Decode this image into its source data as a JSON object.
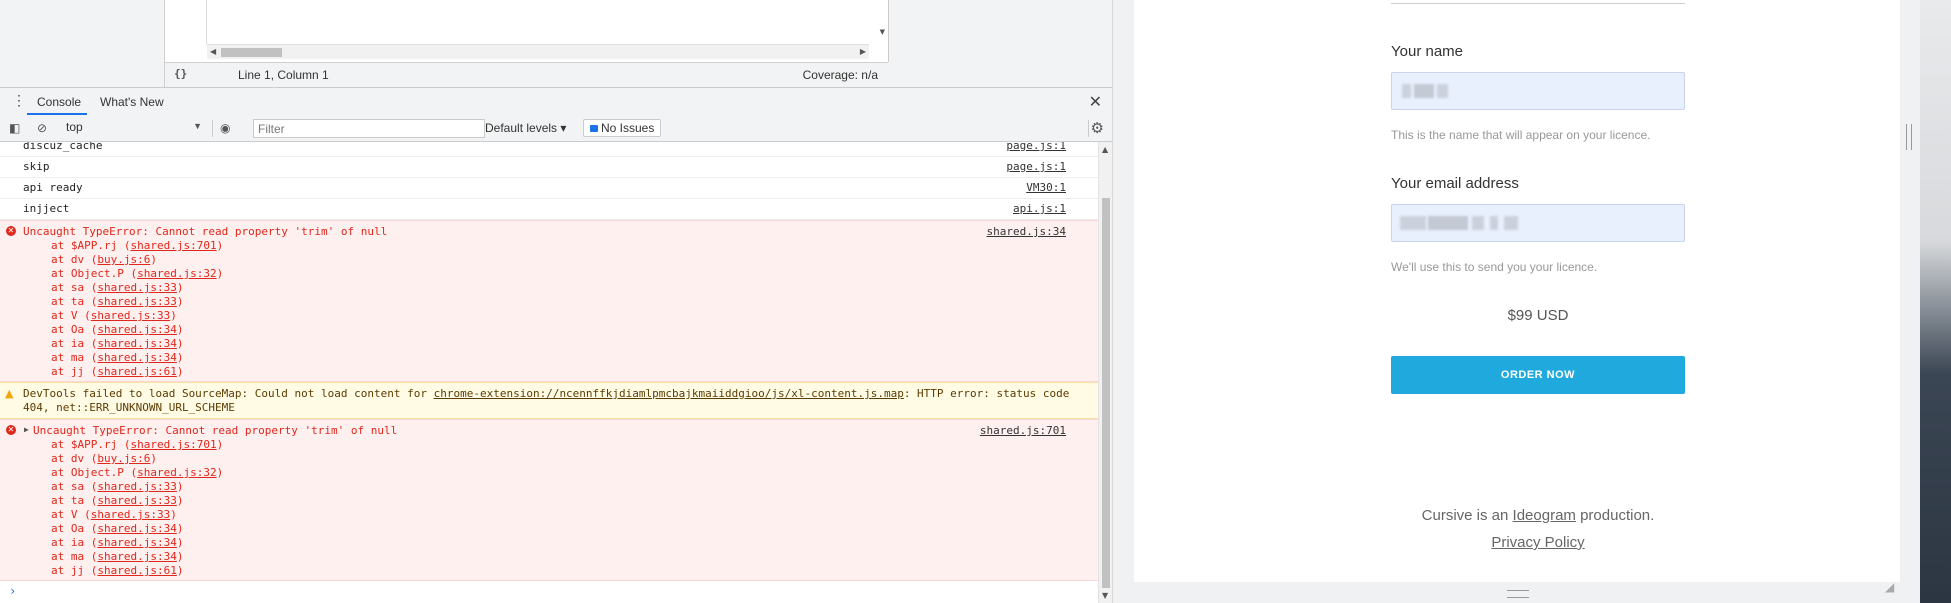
{
  "editor": {
    "braces_icon": "{}",
    "cursor_position": "Line 1, Column 1",
    "coverage": "Coverage: n/a"
  },
  "tabs": {
    "console": "Console",
    "whats_new": "What's New"
  },
  "toolbar": {
    "context": "top",
    "filter_placeholder": "Filter",
    "levels": "Default levels",
    "issues": "No Issues"
  },
  "console": {
    "logs": [
      {
        "msg": "discuz_cache",
        "src": "page.js:1"
      },
      {
        "msg": "skip",
        "src": "page.js:1"
      },
      {
        "msg": "api ready",
        "src": "VM30:1"
      },
      {
        "msg": "injject",
        "src": "api.js:1"
      }
    ],
    "error1": {
      "msg": "Uncaught TypeError: Cannot read property 'trim' of null",
      "src": "shared.js:34",
      "stack": [
        {
          "fn": "at $APP.rj",
          "file": "shared.js:701"
        },
        {
          "fn": "at dv",
          "file": "buy.js:6"
        },
        {
          "fn": "at Object.P",
          "file": "shared.js:32"
        },
        {
          "fn": "at sa",
          "file": "shared.js:33"
        },
        {
          "fn": "at ta",
          "file": "shared.js:33"
        },
        {
          "fn": "at V",
          "file": "shared.js:33"
        },
        {
          "fn": "at Oa",
          "file": "shared.js:34"
        },
        {
          "fn": "at ia",
          "file": "shared.js:34"
        },
        {
          "fn": "at ma",
          "file": "shared.js:34"
        },
        {
          "fn": "at jj",
          "file": "shared.js:61"
        }
      ]
    },
    "warning": {
      "prefix": "DevTools failed to load SourceMap: Could not load content for ",
      "url": "chrome-extension://ncennffkjdiamlpmcbajkmaiiddgioo/js/xl-content.js.map",
      "suffix": ": HTTP error: status code",
      "line2": "404, net::ERR_UNKNOWN_URL_SCHEME"
    },
    "error2": {
      "msg": "Uncaught TypeError: Cannot read property 'trim' of null",
      "src": "shared.js:701",
      "stack": [
        {
          "fn": "at $APP.rj",
          "file": "shared.js:701"
        },
        {
          "fn": "at dv",
          "file": "buy.js:6"
        },
        {
          "fn": "at Object.P",
          "file": "shared.js:32"
        },
        {
          "fn": "at sa",
          "file": "shared.js:33"
        },
        {
          "fn": "at ta",
          "file": "shared.js:33"
        },
        {
          "fn": "at V",
          "file": "shared.js:33"
        },
        {
          "fn": "at Oa",
          "file": "shared.js:34"
        },
        {
          "fn": "at ia",
          "file": "shared.js:34"
        },
        {
          "fn": "at ma",
          "file": "shared.js:34"
        },
        {
          "fn": "at jj",
          "file": "shared.js:61"
        }
      ]
    },
    "prompt": "›"
  },
  "form": {
    "name_label": "Your name",
    "name_help": "This is the name that will appear on your licence.",
    "email_label": "Your email address",
    "email_help": "We'll use this to send you your licence.",
    "price": "$99 USD",
    "order_button": "ORDER NOW",
    "credit_prefix": "Cursive is an ",
    "credit_link": "Ideogram",
    "credit_suffix": " production.",
    "privacy": "Privacy Policy"
  },
  "colors": {
    "accent": "#1fa9dd",
    "error": "#e0271b",
    "warning_bg": "#fffbe5",
    "input_bg": "#e8effd"
  }
}
